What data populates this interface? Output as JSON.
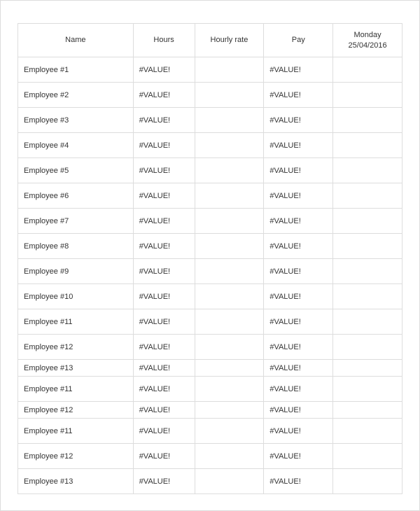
{
  "headers": {
    "name": "Name",
    "hours": "Hours",
    "rate": "Hourly rate",
    "pay": "Pay",
    "day_line1": "Monday",
    "day_line2": "25/04/2016"
  },
  "rows": [
    {
      "name": "Employee #1",
      "hours": "#VALUE!",
      "rate": "",
      "pay": "#VALUE!",
      "day": "",
      "tight": false
    },
    {
      "name": "Employee #2",
      "hours": "#VALUE!",
      "rate": "",
      "pay": "#VALUE!",
      "day": "",
      "tight": false
    },
    {
      "name": "Employee #3",
      "hours": "#VALUE!",
      "rate": "",
      "pay": "#VALUE!",
      "day": "",
      "tight": false
    },
    {
      "name": "Employee #4",
      "hours": "#VALUE!",
      "rate": "",
      "pay": "#VALUE!",
      "day": "",
      "tight": false
    },
    {
      "name": "Employee #5",
      "hours": "#VALUE!",
      "rate": "",
      "pay": "#VALUE!",
      "day": "",
      "tight": false
    },
    {
      "name": "Employee #6",
      "hours": "#VALUE!",
      "rate": "",
      "pay": "#VALUE!",
      "day": "",
      "tight": false
    },
    {
      "name": "Employee #7",
      "hours": "#VALUE!",
      "rate": "",
      "pay": "#VALUE!",
      "day": "",
      "tight": false
    },
    {
      "name": "Employee #8",
      "hours": "#VALUE!",
      "rate": "",
      "pay": "#VALUE!",
      "day": "",
      "tight": false
    },
    {
      "name": "Employee #9",
      "hours": "#VALUE!",
      "rate": "",
      "pay": "#VALUE!",
      "day": "",
      "tight": false
    },
    {
      "name": "Employee #10",
      "hours": "#VALUE!",
      "rate": "",
      "pay": "#VALUE!",
      "day": "",
      "tight": false
    },
    {
      "name": "Employee #11",
      "hours": "#VALUE!",
      "rate": "",
      "pay": "#VALUE!",
      "day": "",
      "tight": false
    },
    {
      "name": "Employee #12",
      "hours": "#VALUE!",
      "rate": "",
      "pay": "#VALUE!",
      "day": "",
      "tight": false
    },
    {
      "name": "Employee #13",
      "hours": "#VALUE!",
      "rate": "",
      "pay": "#VALUE!",
      "day": "",
      "tight": true
    },
    {
      "name": "Employee #11",
      "hours": "#VALUE!",
      "rate": "",
      "pay": "#VALUE!",
      "day": "",
      "tight": false
    },
    {
      "name": "Employee #12",
      "hours": "#VALUE!",
      "rate": "",
      "pay": "#VALUE!",
      "day": "",
      "tight": true
    },
    {
      "name": "Employee #11",
      "hours": "#VALUE!",
      "rate": "",
      "pay": "#VALUE!",
      "day": "",
      "tight": false
    },
    {
      "name": "Employee #12",
      "hours": "#VALUE!",
      "rate": "",
      "pay": "#VALUE!",
      "day": "",
      "tight": false
    },
    {
      "name": "Employee #13",
      "hours": "#VALUE!",
      "rate": "",
      "pay": "#VALUE!",
      "day": "",
      "tight": false
    }
  ]
}
